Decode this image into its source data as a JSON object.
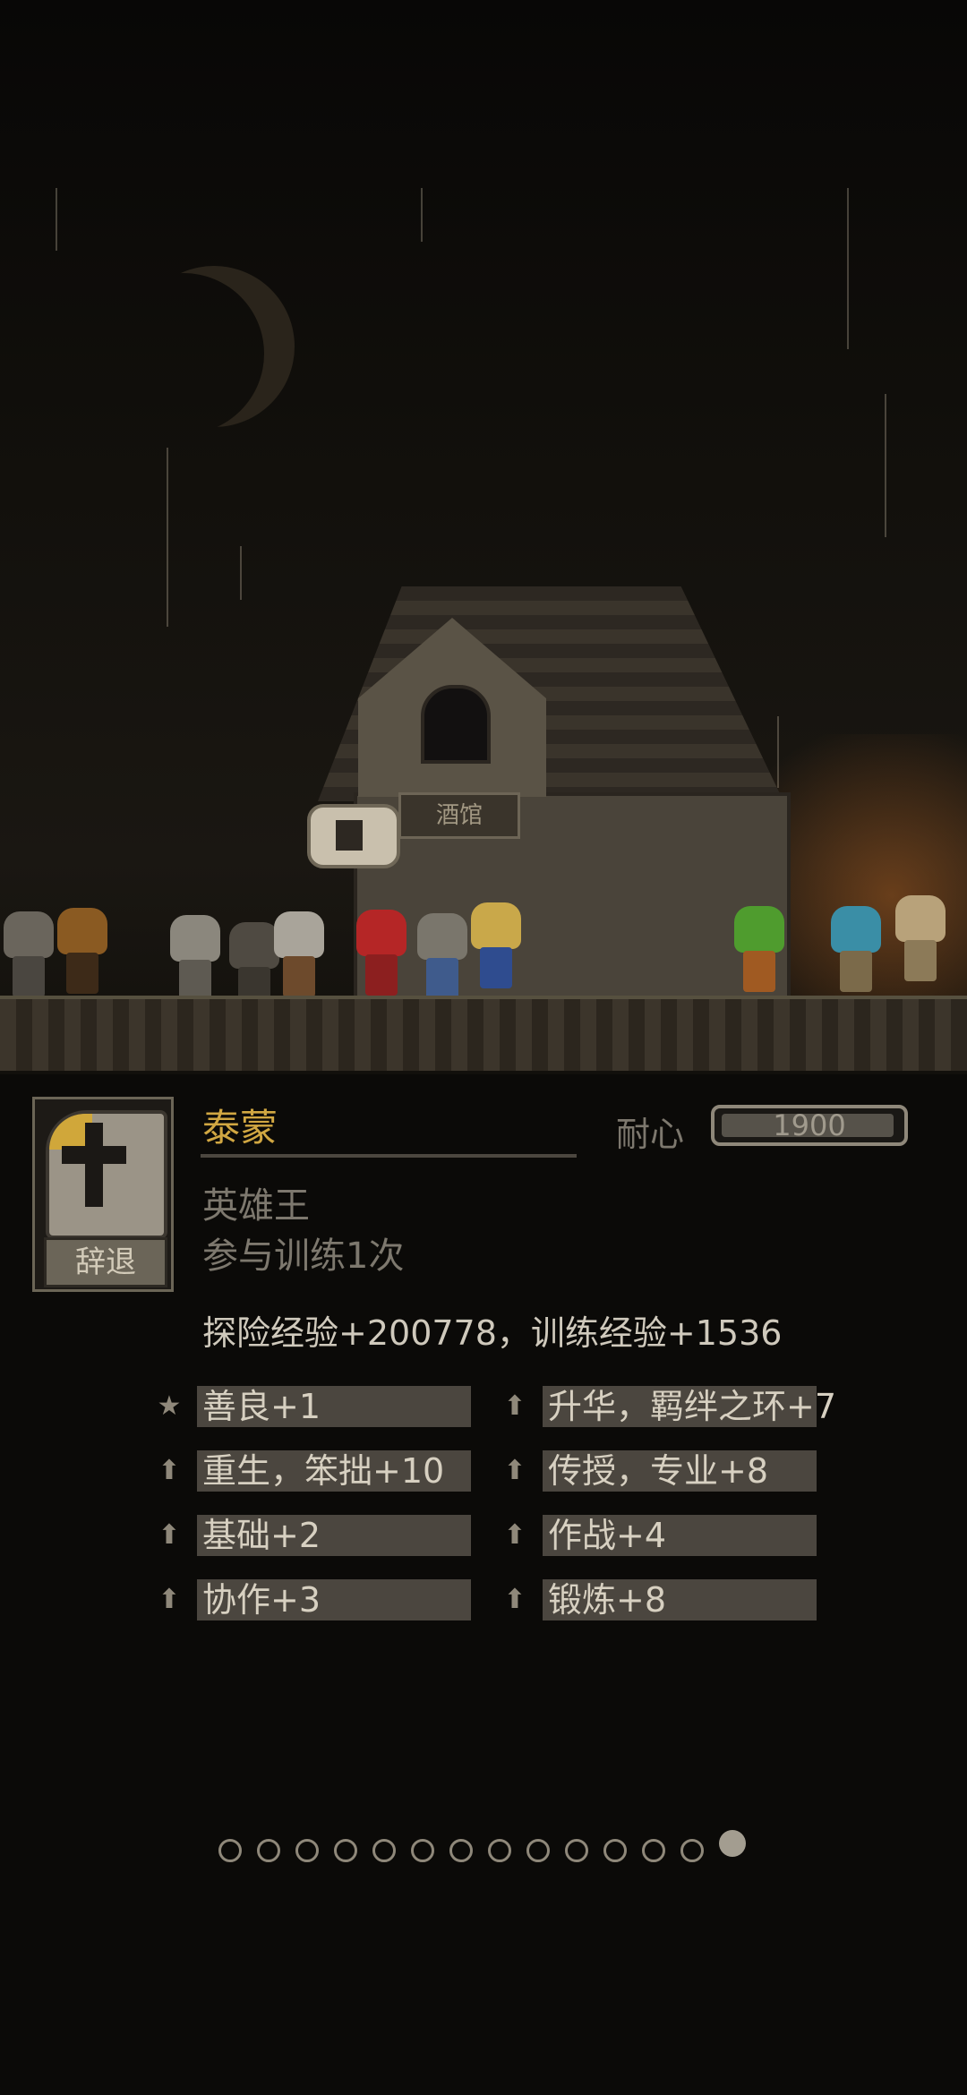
{
  "scene": {
    "tavern_sign": "酒馆"
  },
  "hero": {
    "name": "泰蒙",
    "title": "英雄王",
    "trained": "参与训练1次",
    "dismiss_label": "辞退",
    "patience_label": "耐心",
    "patience_value": "1900",
    "patience_fill_fraction": 0.98,
    "experience": "探险经验+200778，训练经验+1536"
  },
  "traits_left": [
    {
      "icon": "star-icon",
      "label": "善良+1"
    },
    {
      "icon": "arrow-up-icon",
      "label": "重生，笨拙+10"
    },
    {
      "icon": "arrow-up-icon",
      "label": "基础+2"
    },
    {
      "icon": "arrow-up-icon",
      "label": "协作+3"
    }
  ],
  "traits_right": [
    {
      "icon": "arrow-up-icon",
      "label": "升华，羁绊之环+7"
    },
    {
      "icon": "arrow-up-icon",
      "label": "传授，专业+8"
    },
    {
      "icon": "arrow-up-icon",
      "label": "作战+4"
    },
    {
      "icon": "arrow-up-icon",
      "label": "锻炼+8"
    }
  ],
  "pagination": {
    "total": 14,
    "active_index": 13
  },
  "colors": {
    "name": "#d1a742",
    "trait_box": "#4b463f",
    "background": "#0b0a08"
  }
}
